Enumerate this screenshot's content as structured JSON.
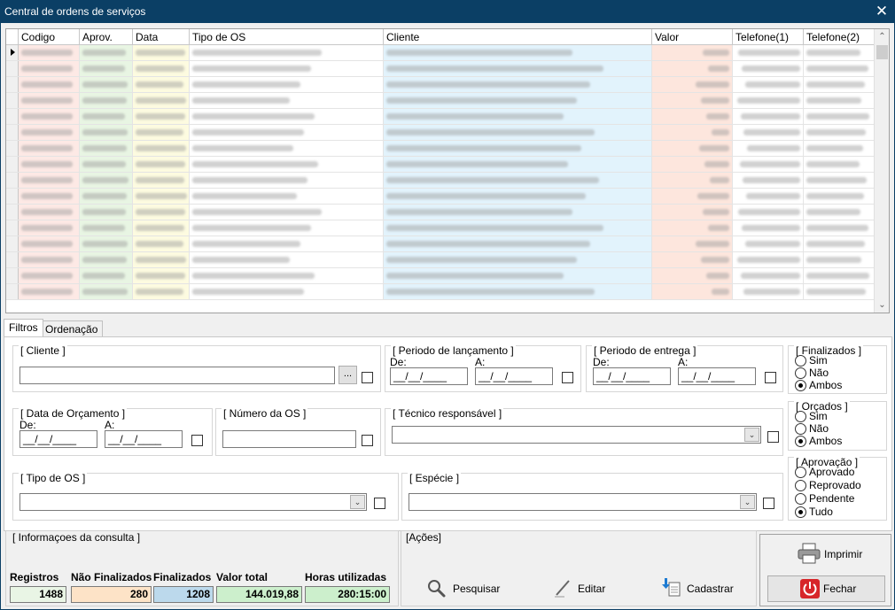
{
  "window": {
    "title": "Central de ordens de serviços",
    "close_glyph": "✕"
  },
  "grid": {
    "columns": [
      "Codigo",
      "Aprov.",
      "Data",
      "Tipo de OS",
      "Cliente",
      "Valor",
      "Telefone(1)",
      "Telefone(2)"
    ],
    "row_count": 16,
    "colors": {
      "codigo": "#fde9e5",
      "aprov": "#e8f5e3",
      "data": "#fdfbe0",
      "cliente": "#e2f3fc",
      "valor": "#fde6dd"
    }
  },
  "tabs": [
    "Filtros",
    "Ordenação"
  ],
  "filters": {
    "cliente": {
      "legend": "[ Cliente ]",
      "browse": "..."
    },
    "periodo_lancamento": {
      "legend": "[ Periodo de lançamento ]",
      "de": "De:",
      "a": "A:",
      "mask": "__/__/____"
    },
    "periodo_entrega": {
      "legend": "[ Periodo de entrega ]",
      "de": "De:",
      "a": "A:",
      "mask": "__/__/____"
    },
    "finalizados": {
      "legend": "[ Finalizados ]",
      "options": [
        "Sim",
        "Não",
        "Ambos"
      ]
    },
    "data_orcamento": {
      "legend": "[ Data de Orçamento ]",
      "de": "De:",
      "a": "A:",
      "mask": "__/__/____"
    },
    "numero_os": {
      "legend": "[ Número da OS ]"
    },
    "tecnico": {
      "legend": "[ Técnico responsável ]"
    },
    "orcados": {
      "legend": "[ Orçados ]",
      "options": [
        "Sim",
        "Não",
        "Ambos"
      ]
    },
    "tipo_os": {
      "legend": "[ Tipo de OS ]"
    },
    "especie": {
      "legend": "[ Espécie ]"
    },
    "aprovacao": {
      "legend": "[ Aprovação ]",
      "options": [
        "Aprovado",
        "Reprovado",
        "Pendente",
        "Tudo"
      ]
    }
  },
  "info": {
    "legend": "[ Informaçoes da consulta ]",
    "registros_label": "Registros",
    "registros": "1488",
    "nao_finalizados_label": "Não Finalizados",
    "nao_finalizados": "280",
    "finalizados_label": "Finalizados",
    "finalizados": "1208",
    "valor_total_label": "Valor total",
    "valor_total": "144.019,88",
    "horas_label": "Horas utilizadas",
    "horas": "280:15:00"
  },
  "acoes": {
    "legend": "[Ações]",
    "pesquisar": "Pesquisar",
    "editar": "Editar",
    "cadastrar": "Cadastrar"
  },
  "side": {
    "imprimir": "Imprimir",
    "fechar": "Fechar"
  }
}
